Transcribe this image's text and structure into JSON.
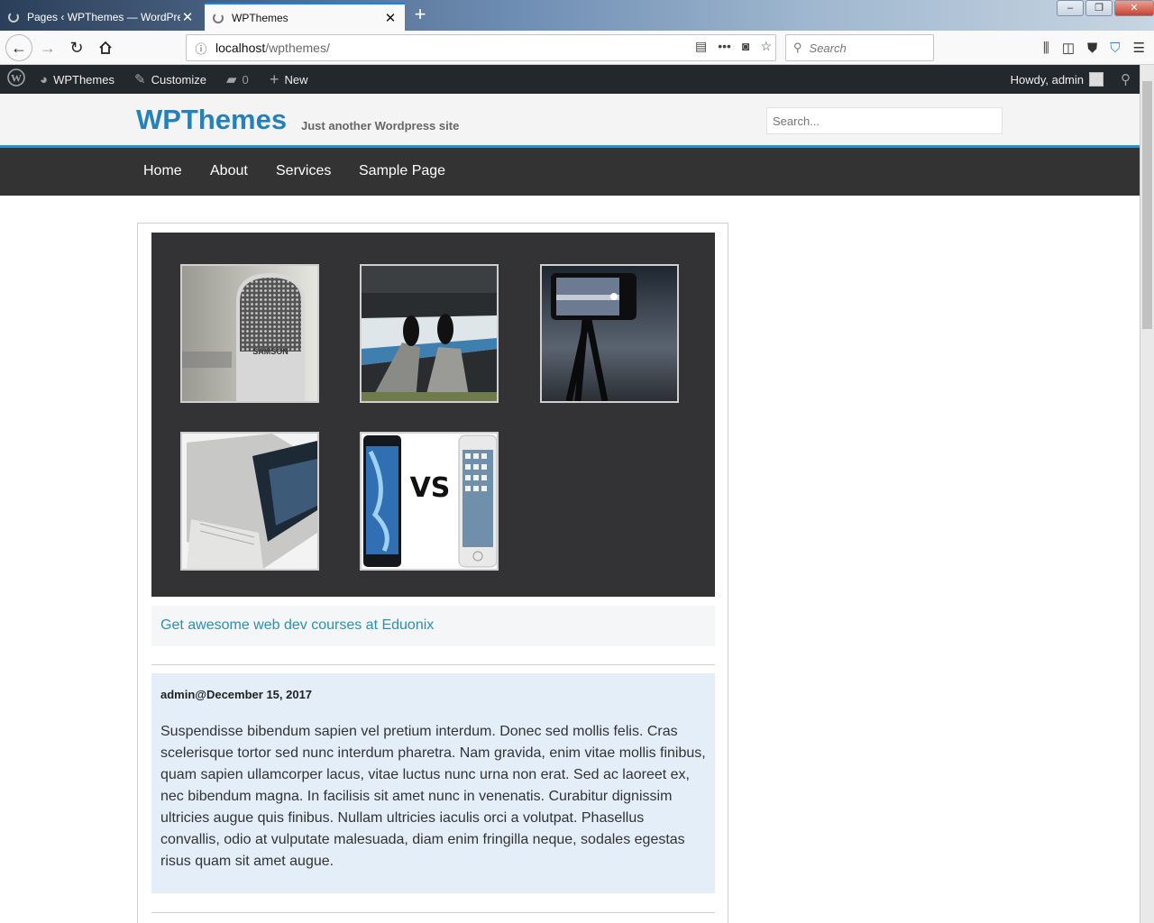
{
  "browser": {
    "tabs": [
      {
        "title": "Pages ‹ WPThemes — WordPress",
        "active": false
      },
      {
        "title": "WPThemes",
        "active": true
      }
    ],
    "url_host": "localhost",
    "url_path": "/wpthemes/",
    "search_placeholder": "Search"
  },
  "adminbar": {
    "site_name": "WPThemes",
    "customize": "Customize",
    "comments_count": "0",
    "new_label": "New",
    "howdy": "Howdy, admin"
  },
  "site": {
    "title": "WPThemes",
    "tagline": "Just another Wordpress site",
    "search_placeholder": "Search..."
  },
  "nav": [
    "Home",
    "About",
    "Services",
    "Sample Page"
  ],
  "promo_link": "Get awesome web dev courses at Eduonix",
  "post": {
    "meta": "admin@December 15, 2017",
    "body": "Suspendisse bibendum sapien vel pretium interdum. Donec sed mollis felis. Cras scelerisque tortor sed nunc interdum pharetra. Nam gravida, enim vitae mollis finibus, quam sapien ullamcorper lacus, vitae luctus nunc urna non erat. Sed ac laoreet ex, nec bibendum magna. In facilisis sit amet nunc in venenatis. Curabitur dignissim ultricies augue quis finibus. Nullam ultricies iaculis orci a volutpat. Phasellus convallis, odio at vulputate malesuada, diam enim fringilla neque, sodales egestas risus quam sit amet augue."
  },
  "gallery": {
    "vs_text": "VS",
    "mic_text": "SAMSON"
  },
  "colors": {
    "accent": "#2b93cc",
    "title": "#2581b8",
    "nav_bg": "#333333",
    "admin_bg": "#23282d",
    "post_bg": "#e3eef8"
  }
}
